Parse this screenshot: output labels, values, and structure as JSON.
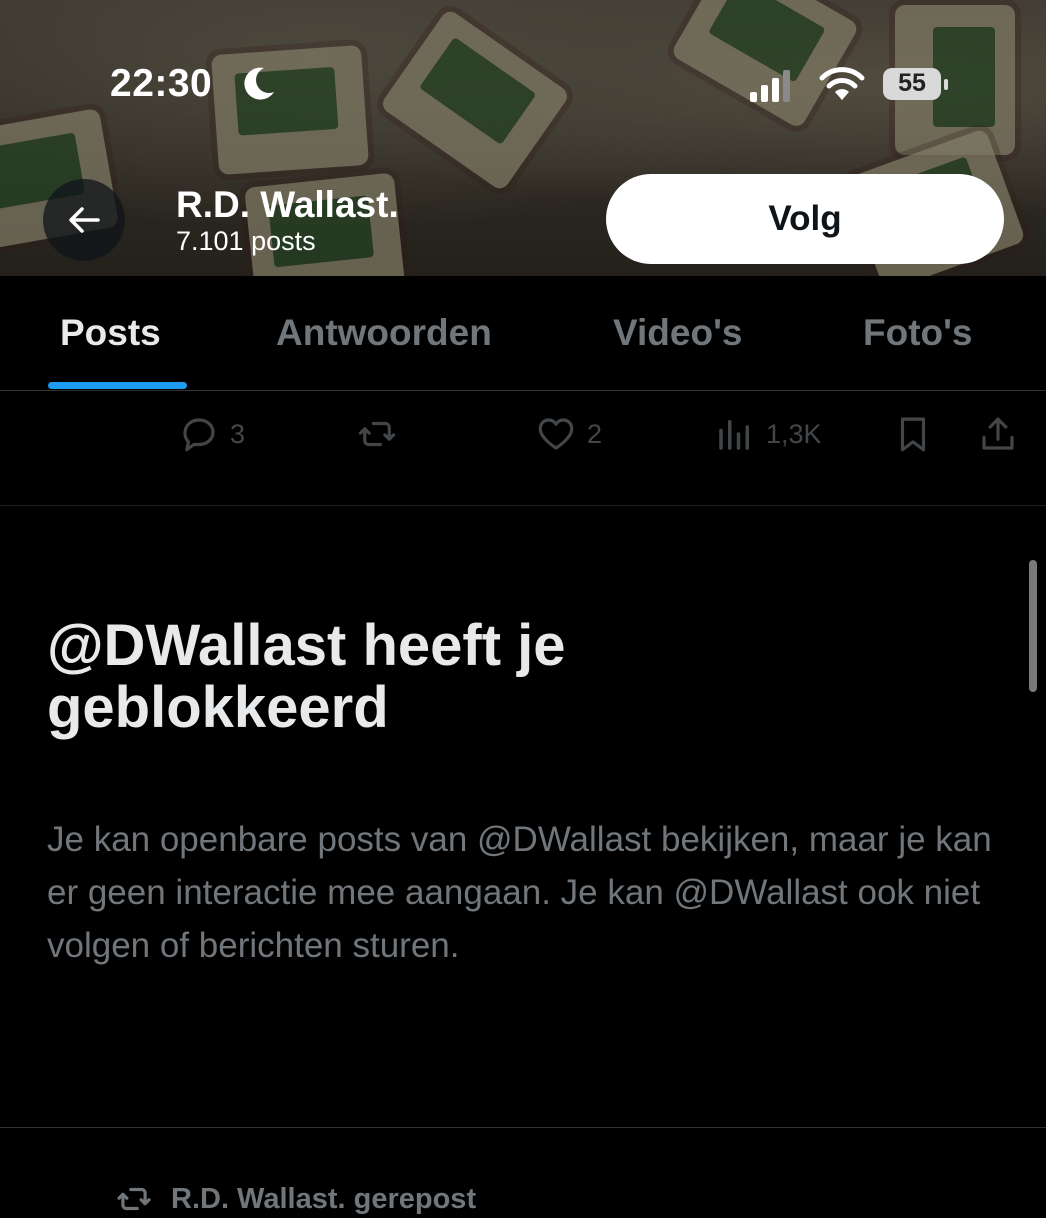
{
  "status_bar": {
    "time": "22:30",
    "battery": "55"
  },
  "header": {
    "name": "R.D. Wallast.",
    "posts": "7.101 posts",
    "follow_label": "Volg"
  },
  "tabs": [
    {
      "label": "Posts",
      "active": true
    },
    {
      "label": "Antwoorden",
      "active": false
    },
    {
      "label": "Video's",
      "active": false
    },
    {
      "label": "Foto's",
      "active": false
    }
  ],
  "post_actions": {
    "replies": "3",
    "reposts": "",
    "likes": "2",
    "views": "1,3K"
  },
  "blocked": {
    "title": "@DWallast heeft je geblokkeerd",
    "description": "Je kan openbare posts van @DWallast bekijken, maar je kan er geen interactie mee aangaan. Je kan @DWallast ook niet volgen of berichten sturen."
  },
  "next_post": {
    "repost_label": "R.D. Wallast. gerepost"
  },
  "colors": {
    "accent": "#1d9bf0",
    "text_primary": "#e7e9ea",
    "text_secondary": "#71767b",
    "background": "#000000",
    "divider": "#2f3336"
  }
}
